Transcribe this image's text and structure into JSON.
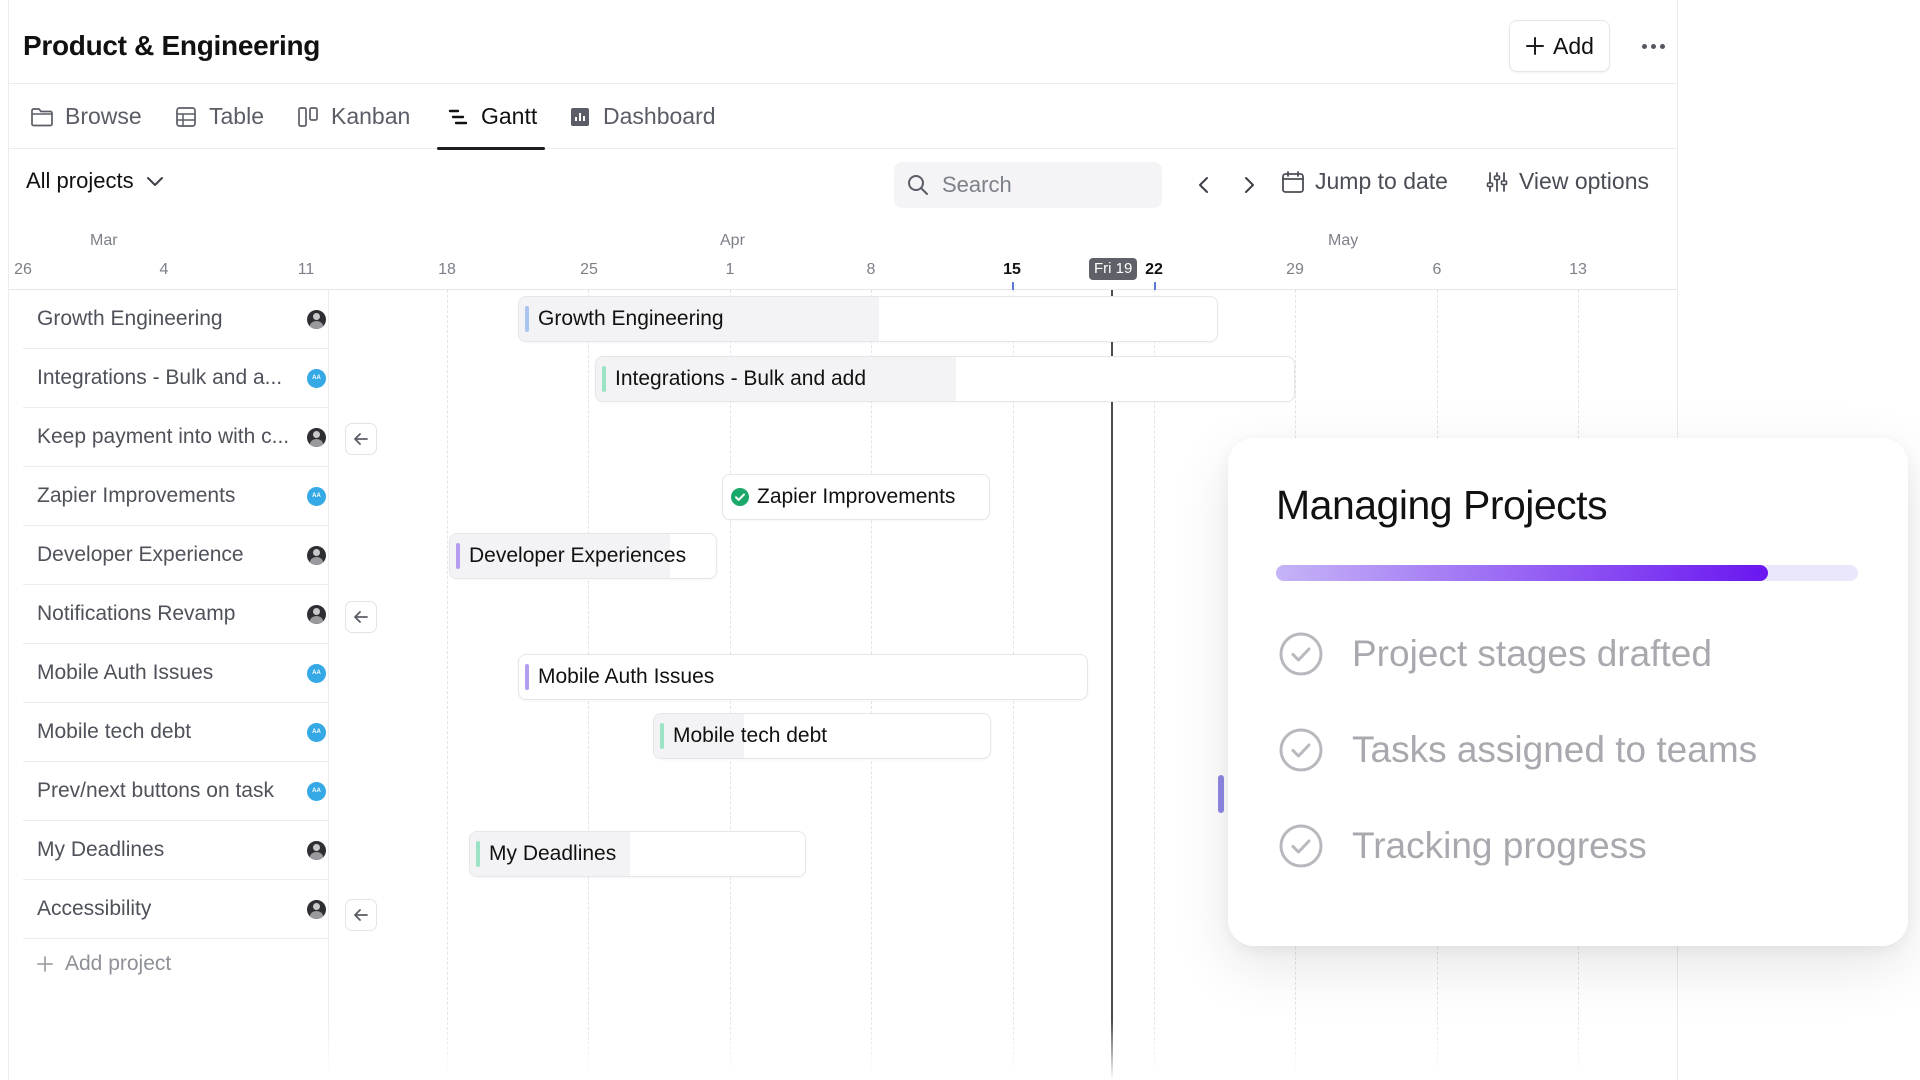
{
  "header": {
    "title": "Product & Engineering",
    "add_label": "Add"
  },
  "tabs": [
    {
      "label": "Browse",
      "icon": "folder-icon",
      "active": false
    },
    {
      "label": "Table",
      "icon": "table-icon",
      "active": false
    },
    {
      "label": "Kanban",
      "icon": "kanban-icon",
      "active": false
    },
    {
      "label": "Gantt",
      "icon": "gantt-icon",
      "active": true
    },
    {
      "label": "Dashboard",
      "icon": "chart-icon",
      "active": false
    }
  ],
  "toolbar": {
    "filter_label": "All projects",
    "search_placeholder": "Search",
    "jump_label": "Jump to date",
    "view_options_label": "View options"
  },
  "timeline": {
    "months": [
      "Mar",
      "Apr",
      "May"
    ],
    "days": [
      "26",
      "4",
      "11",
      "18",
      "25",
      "1",
      "8",
      "15",
      "22",
      "29",
      "6",
      "13"
    ],
    "today_label": "Fri 19",
    "highlighted_days": [
      "15",
      "22"
    ]
  },
  "projects": [
    {
      "name": "Growth Engineering",
      "avatar": "photo"
    },
    {
      "name": "Integrations - Bulk and a...",
      "avatar": "AA"
    },
    {
      "name": "Keep payment into with c...",
      "avatar": "photo"
    },
    {
      "name": "Zapier Improvements",
      "avatar": "AA"
    },
    {
      "name": "Developer Experience",
      "avatar": "photo"
    },
    {
      "name": "Notifications Revamp",
      "avatar": "photo"
    },
    {
      "name": "Mobile Auth Issues",
      "avatar": "AA"
    },
    {
      "name": "Mobile tech debt",
      "avatar": "AA"
    },
    {
      "name": "Prev/next buttons on task",
      "avatar": "AA"
    },
    {
      "name": "My Deadlines",
      "avatar": "photo"
    },
    {
      "name": "Accessibility",
      "avatar": "photo"
    }
  ],
  "add_project_label": "Add project",
  "bars": [
    {
      "label": "Growth Engineering",
      "accent": "#a9c4ef",
      "done": false
    },
    {
      "label": "Integrations - Bulk and add",
      "accent": "#9be3c5",
      "done": false
    },
    {
      "label": "Zapier Improvements",
      "accent": "#1aa96b",
      "done": true
    },
    {
      "label": "Developer Experiences",
      "accent": "#b49cf0",
      "done": false
    },
    {
      "label": "Mobile Auth Issues",
      "accent": "#b49cf0",
      "done": false
    },
    {
      "label": "Mobile tech debt",
      "accent": "#9be3c5",
      "done": false
    },
    {
      "label": "My Deadlines",
      "accent": "#9be3c5",
      "done": false
    }
  ],
  "card": {
    "title": "Managing Projects",
    "progress_fraction": 0.845,
    "items": [
      "Project stages drafted",
      "Tasks assigned to teams",
      "Tracking progress"
    ]
  },
  "colors": {
    "progress_start": "#c5b4f7",
    "progress_end": "#6a16f0",
    "avatar_aa": "#35a9e6",
    "today_line": "#4b4d53"
  }
}
